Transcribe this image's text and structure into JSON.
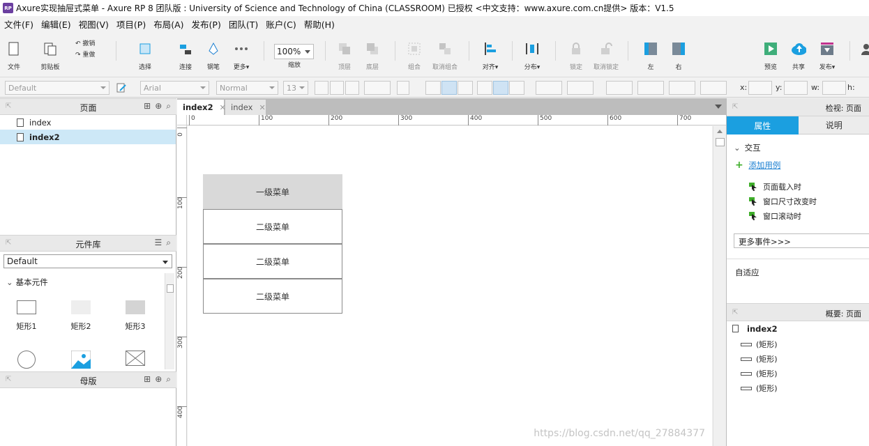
{
  "window": {
    "app_icon": "RP",
    "title": "Axure实现抽屉式菜单 - Axure RP 8 团队版 : University of Science and Technology of China (CLASSROOM) 已授权      <中文支持：www.axure.com.cn提供> 版本：V1.5"
  },
  "menubar": [
    "文件(F)",
    "编辑(E)",
    "视图(V)",
    "项目(P)",
    "布局(A)",
    "发布(P)",
    "团队(T)",
    "账户(C)",
    "帮助(H)"
  ],
  "toolbar": {
    "file": "文件",
    "clipboard": "剪贴板",
    "undo": "撤销",
    "redo": "重做",
    "select": "选择",
    "connect": "连接",
    "pen": "钢笔",
    "more": "更多▾",
    "zoom_value": "100%",
    "zoom": "缩放",
    "front": "顶层",
    "back": "底层",
    "group": "组合",
    "ungroup": "取消组合",
    "align": "对齐▾",
    "distribute": "分布▾",
    "lock": "锁定",
    "unlock": "取消锁定",
    "left": "左",
    "right": "右",
    "preview": "预览",
    "share": "共享",
    "publish": "发布▾"
  },
  "formatbar": {
    "style": "Default",
    "font": "Arial",
    "weight": "Normal",
    "size": "13",
    "x_label": "x:",
    "y_label": "y:",
    "w_label": "w:",
    "h_label": "h:"
  },
  "pages_panel": {
    "title": "页面",
    "items": [
      {
        "label": "index",
        "selected": false
      },
      {
        "label": "index2",
        "selected": true
      }
    ]
  },
  "library_panel": {
    "title": "元件库",
    "selected_library": "Default",
    "section": "基本元件",
    "widgets": [
      "矩形1",
      "矩形2",
      "矩形3"
    ]
  },
  "masters_panel": {
    "title": "母版"
  },
  "tabs": [
    {
      "label": "index2",
      "active": true
    },
    {
      "label": "index",
      "active": false
    }
  ],
  "ruler": {
    "h_ticks": [
      "0",
      "100",
      "200",
      "300",
      "400",
      "500",
      "600",
      "700"
    ],
    "v_ticks": [
      "0",
      "100",
      "200",
      "300",
      "400"
    ]
  },
  "canvas": {
    "level1": "一级菜单",
    "level2": [
      "二级菜单",
      "二级菜单",
      "二级菜单"
    ],
    "watermark": "https://blog.csdn.net/qq_27884377"
  },
  "inspector": {
    "title": "检视: 页面",
    "tab_properties": "属性",
    "tab_notes": "说明",
    "interaction": "交互",
    "add_case": "添加用例",
    "events": [
      "页面载入时",
      "窗口尺寸改变时",
      "窗口滚动时"
    ],
    "more_events": "更多事件>>>",
    "adaptive": "自适应"
  },
  "outline": {
    "title": "概要: 页面",
    "root": "index2",
    "items": [
      "(矩形)",
      "(矩形)",
      "(矩形)",
      "(矩形)"
    ]
  },
  "colors": {
    "accent": "#1b9fe0",
    "selected_row": "#cde8f7",
    "menu_level1": "#d9d9d9",
    "add_green": "#3fae2a"
  }
}
